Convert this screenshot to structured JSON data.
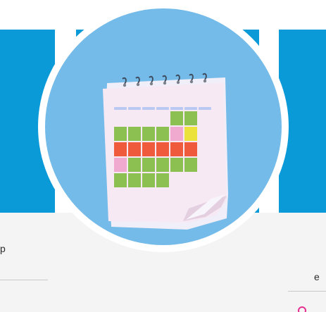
{
  "left_snippet": "p",
  "right_snippet": "e",
  "calendar": {
    "rows": [
      [
        "none",
        "none",
        "none",
        "none",
        "green",
        "green"
      ],
      [
        "green",
        "green",
        "green",
        "green",
        "pink",
        "yellow"
      ],
      [
        "orange",
        "orange",
        "orange",
        "orange",
        "orange",
        "orange"
      ],
      [
        "pink",
        "green",
        "green",
        "green",
        "green",
        "green"
      ],
      [
        "green",
        "green",
        "green",
        "green",
        "none",
        "none"
      ]
    ],
    "colors": {
      "green": "#8cc152",
      "pink": "#f0a9cf",
      "yellow": "#ebe33b",
      "orange": "#f05a3c",
      "header": "#b9c9f1",
      "page": "#f7e9f3",
      "ring": "#3e4c5f",
      "circle": "#74bbe9",
      "band": "#0b9ad8"
    }
  }
}
